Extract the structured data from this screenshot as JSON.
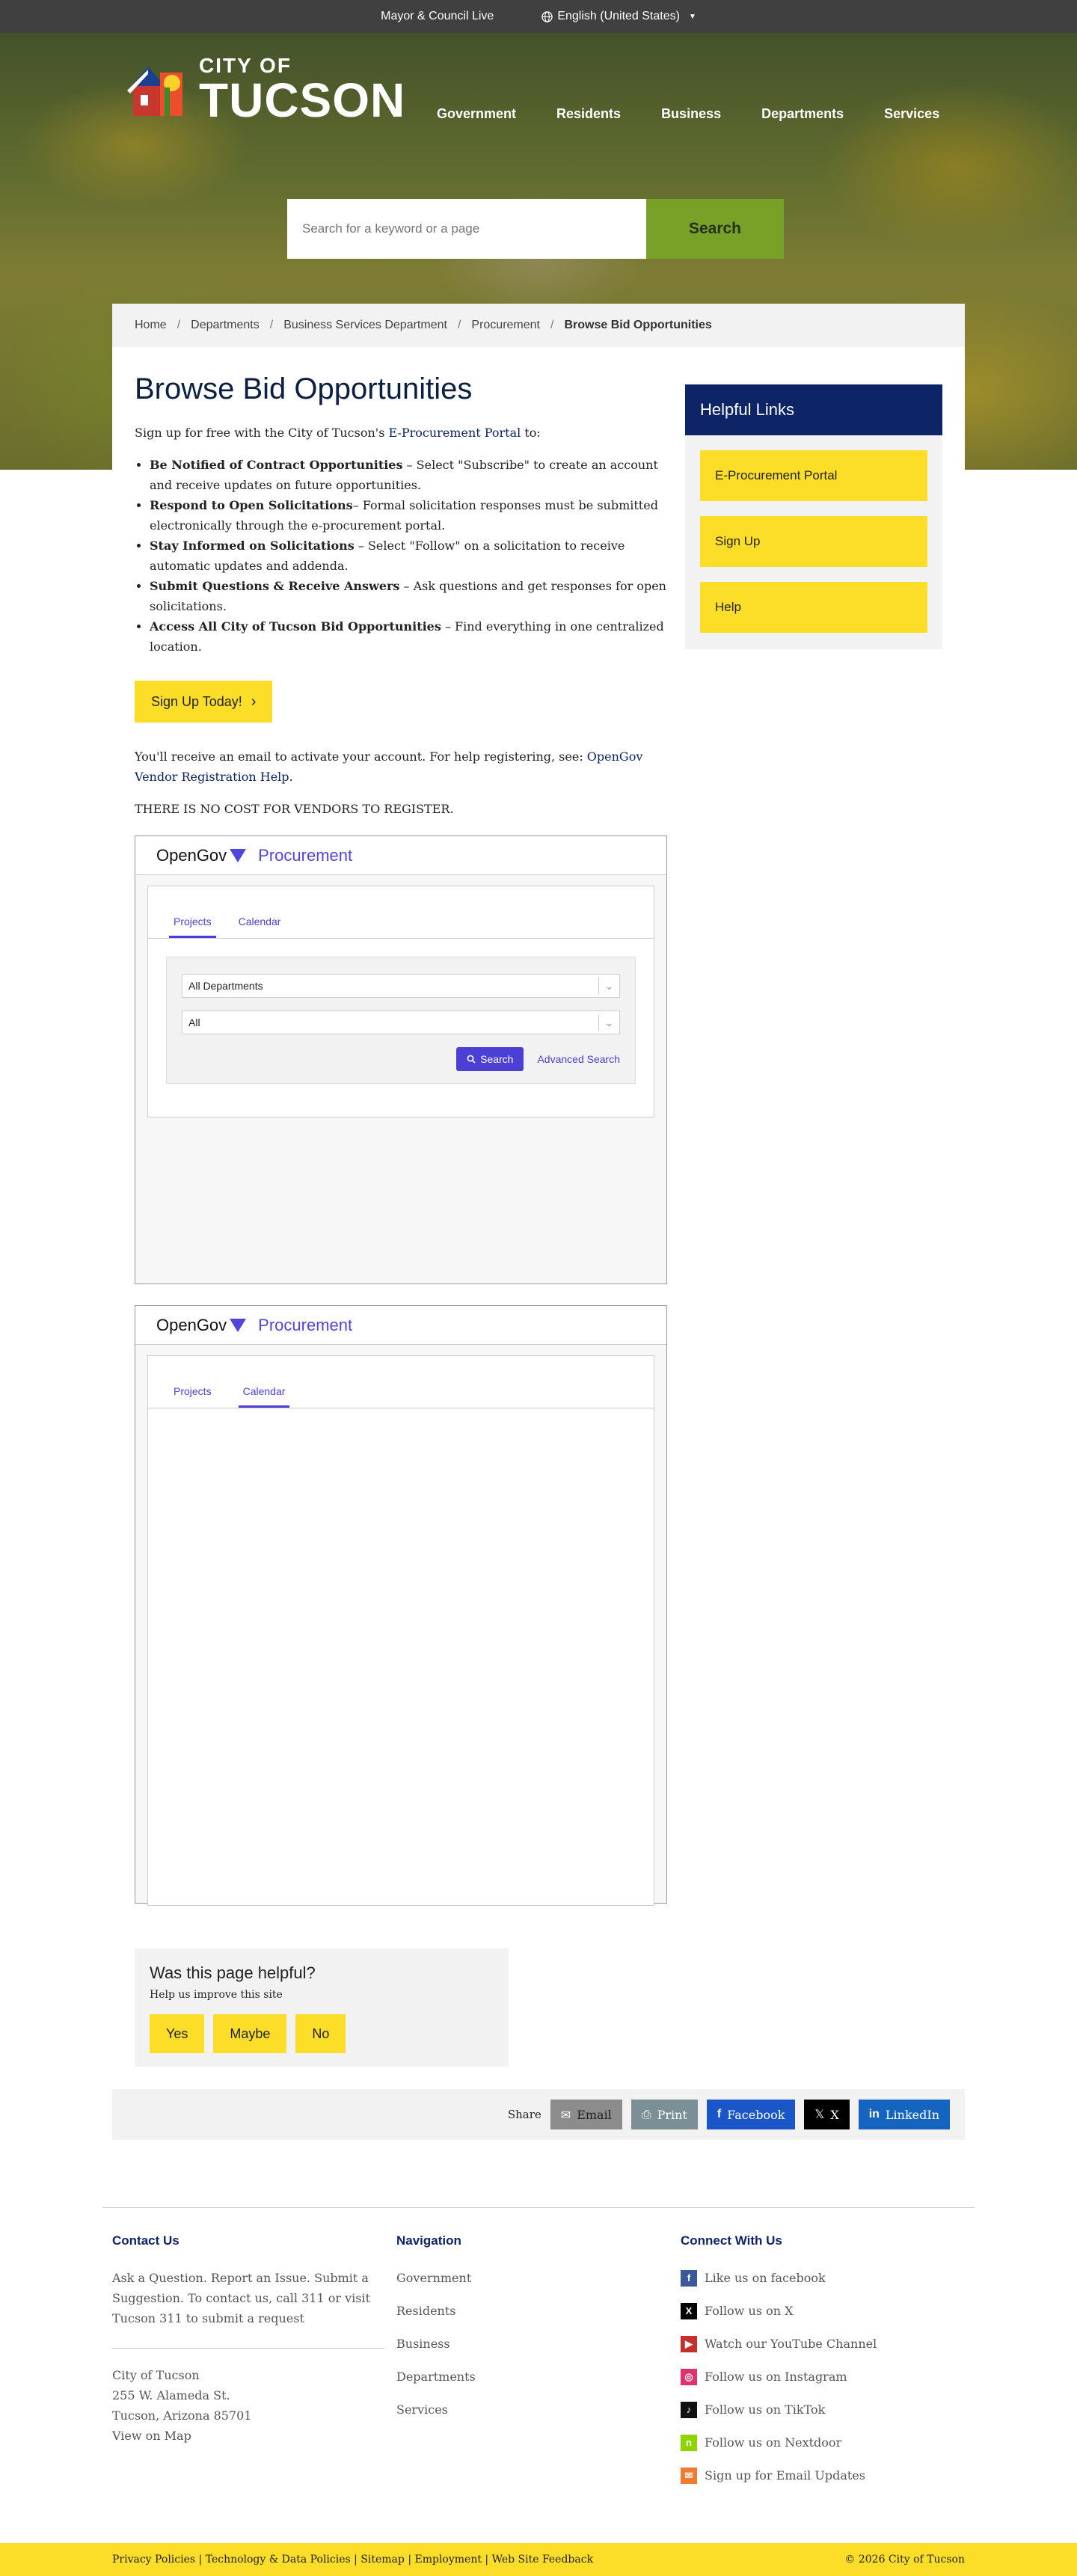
{
  "topbar": {
    "live": "Mayor & Council Live",
    "language": "English (United States)"
  },
  "logo": {
    "small": "CITY OF",
    "big": "TUCSON"
  },
  "nav": [
    "Government",
    "Residents",
    "Business",
    "Departments",
    "Services"
  ],
  "search": {
    "placeholder": "Search for a keyword or a page",
    "button": "Search"
  },
  "breadcrumb": [
    "Home",
    "Departments",
    "Business Services Department",
    "Procurement",
    "Browse Bid Opportunities"
  ],
  "main": {
    "title": "Browse Bid Opportunities",
    "intro_pre": "Sign up for free with the City of Tucson's ",
    "intro_link": "E-Procurement Portal",
    "intro_post": " to:",
    "bullets": [
      {
        "bold": "Be Notified of Contract Opportunities",
        "text": " – Select \"Subscribe\" to create an account and receive updates on future opportunities."
      },
      {
        "bold": "Respond to Open Solicitations",
        "text": "– Formal solicitation responses must be submitted electronically through the e-procurement portal."
      },
      {
        "bold": "Stay Informed on Solicitations",
        "text": " – Select \"Follow\" on a solicitation to receive automatic updates and addenda."
      },
      {
        "bold": "Submit Questions & Receive Answers",
        "text": " – Ask questions and get responses for open solicitations."
      },
      {
        "bold": "Access All City of Tucson Bid Opportunities",
        "text": " – Find everything in one centralized location."
      }
    ],
    "cta": "Sign Up Today!",
    "email_pre": "You'll receive an email to activate your account. For help registering, see: ",
    "email_link": "OpenGov Vendor Registration Help",
    "email_post": ".",
    "no_cost": "THERE IS NO COST FOR VENDORS TO REGISTER."
  },
  "embed": {
    "brand": "OpenGov",
    "product": "Procurement",
    "tabs": [
      "Projects",
      "Calendar"
    ],
    "dept_select": "All Departments",
    "status_select": "All",
    "search_button": "Search",
    "advanced": "Advanced Search"
  },
  "aside": {
    "title": "Helpful Links",
    "links": [
      "E-Procurement Portal",
      "Sign Up",
      "Help"
    ]
  },
  "feedback": {
    "title": "Was this page helpful?",
    "sub": "Help us improve this site",
    "buttons": [
      "Yes",
      "Maybe",
      "No"
    ]
  },
  "share": {
    "label": "Share",
    "buttons": [
      "Email",
      "Print",
      "Facebook",
      "X",
      "LinkedIn"
    ]
  },
  "footer": {
    "contact_title": "Contact Us",
    "contact_text_pre": "Ask a Question. Report an Issue. Submit a Suggestion. To contact us, call 311 or visit ",
    "contact_link": "Tucson 311 to submit a request",
    "address": [
      "City of Tucson",
      "255 W. Alameda St.",
      "Tucson, Arizona 85701"
    ],
    "map_link": "View on Map",
    "nav_title": "Navigation",
    "nav": [
      "Government",
      "Residents",
      "Business",
      "Departments",
      "Services"
    ],
    "connect_title": "Connect With Us",
    "social": [
      "Like us on facebook",
      "Follow us on X",
      "Watch our YouTube Channel",
      "Follow us on Instagram",
      "Follow us on TikTok",
      "Follow us on Nextdoor",
      "Sign up for Email Updates"
    ]
  },
  "bottom": {
    "links": "Privacy Policies | Technology & Data Policies | Sitemap | Employment | Web Site Feedback",
    "copyright": "© 2026 City of Tucson"
  },
  "colors": {
    "navy": "#0d2466",
    "yellow": "#fcdd28",
    "green": "#79a128",
    "opengov": "#4b3fd6"
  }
}
